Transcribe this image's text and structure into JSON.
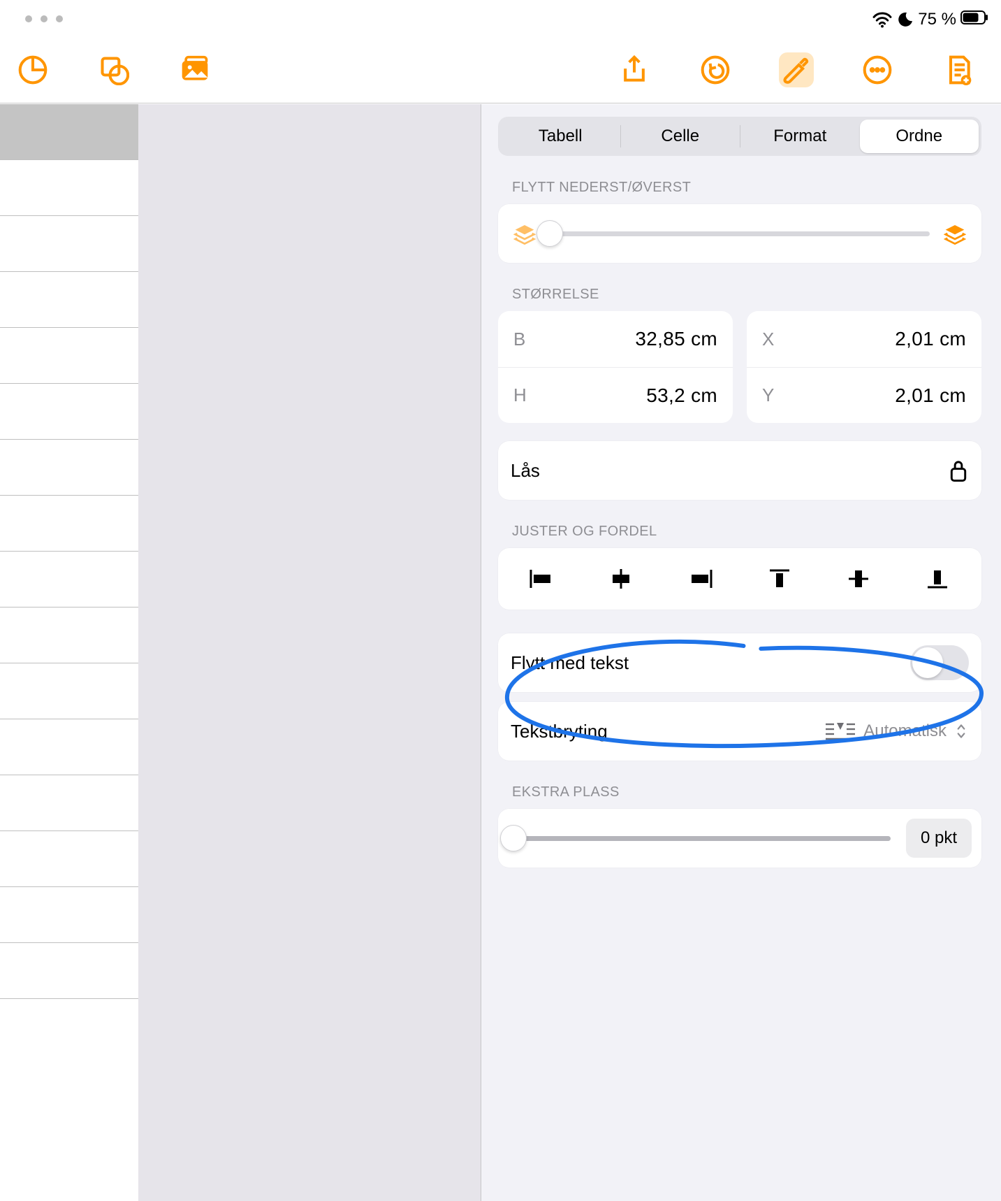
{
  "status": {
    "battery_text": "75 %"
  },
  "toolbar_icons": {
    "left": [
      "chart-pie",
      "shape",
      "media"
    ],
    "right": [
      "share",
      "undo-circle",
      "paintbrush",
      "more-circle",
      "document-settings"
    ]
  },
  "tabs": {
    "items": [
      "Tabell",
      "Celle",
      "Format",
      "Ordne"
    ],
    "selected": "Ordne"
  },
  "sections": {
    "move_layer": "FLYTT NEDERST/ØVERST",
    "size": "STØRRELSE",
    "align": "JUSTER OG FORDEL",
    "extra": "EKSTRA PLASS"
  },
  "size": {
    "w_label": "B",
    "w_value": "32,85 cm",
    "h_label": "H",
    "h_value": "53,2 cm",
    "x_label": "X",
    "x_value": "2,01 cm",
    "y_label": "Y",
    "y_value": "2,01 cm"
  },
  "lock_label": "Lås",
  "move_with_text_label": "Flytt med tekst",
  "move_with_text_on": false,
  "text_wrap": {
    "label": "Tekstbryting",
    "value": "Automatisk"
  },
  "extra_space": {
    "value_text": "0 pkt"
  },
  "align_icons": [
    "align-left",
    "align-hcenter",
    "align-right",
    "align-top",
    "align-vcenter",
    "align-bottom"
  ]
}
